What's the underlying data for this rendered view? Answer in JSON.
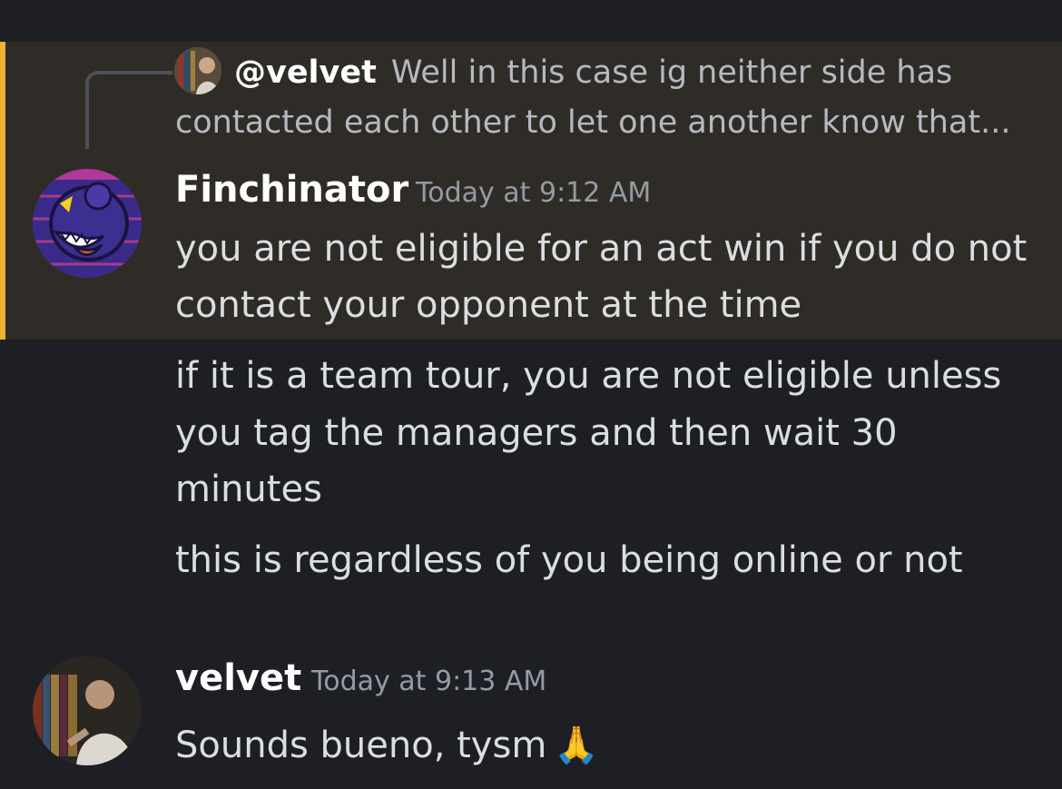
{
  "reply": {
    "author": "@velvet",
    "text_line1": "Well in this case ig neither side has",
    "text_line2": "contacted each other to let one another know that..."
  },
  "messages": [
    {
      "author": "Finchinator",
      "timestamp": "Today at 9:12 AM",
      "lines": [
        "you are not eligible for an act win if you do not",
        "contact your opponent at the time"
      ]
    },
    {
      "lines": [
        "if it is a team tour, you are not eligible unless",
        "you tag the managers and then wait 30",
        "minutes"
      ]
    },
    {
      "lines": [
        "this is regardless of you being online or not"
      ]
    },
    {
      "author": "velvet",
      "timestamp": "Today at 9:13 AM",
      "text": "Sounds bueno, tysm",
      "emoji": "🙏"
    }
  ],
  "colors": {
    "background": "#1e1f25",
    "highlight": "#2f2c27",
    "highlight_bar": "#f0b232",
    "timestamp": "#949ba4"
  },
  "icons": {
    "reply_avatar": "user-photo-avatar",
    "finch_avatar": "cartoon-fish-avatar",
    "velvet_avatar": "user-photo-avatar"
  }
}
